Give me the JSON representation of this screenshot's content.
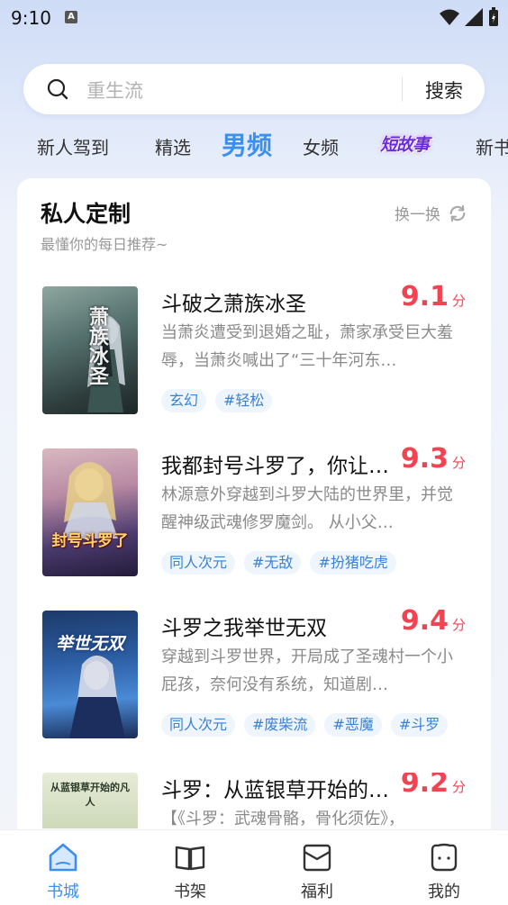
{
  "status_bar": {
    "time": "9:10",
    "badge": "A"
  },
  "search": {
    "placeholder": "重生流",
    "button": "搜索"
  },
  "tabs": [
    {
      "label": "新人驾到"
    },
    {
      "label": "精选"
    },
    {
      "label": "男频",
      "active": true
    },
    {
      "label": "女频"
    },
    {
      "label": "短故事"
    },
    {
      "label": "新书"
    }
  ],
  "section": {
    "title": "私人定制",
    "subtitle": "最懂你的每日推荐~",
    "refresh": "换一换"
  },
  "books": [
    {
      "title": "斗破之萧族冰圣",
      "score": "9.1",
      "unit": "分",
      "desc": "当萧炎遭受到退婚之耻，萧家承受巨大羞辱，当萧炎喊出了“三十年河东…",
      "tags": [
        "玄幻",
        "#轻松"
      ],
      "cover_text": "萧族冰圣"
    },
    {
      "title": "我都封号斗罗了，你让…",
      "score": "9.3",
      "unit": "分",
      "desc": "林源意外穿越到斗罗大陆的世界里，并觉醒神级武魂修罗魔剑。 从小父…",
      "tags": [
        "同人次元",
        "#无敌",
        "#扮猪吃虎"
      ],
      "cover_text": "封号斗罗了"
    },
    {
      "title": "斗罗之我举世无双",
      "score": "9.4",
      "unit": "分",
      "desc": "穿越到斗罗世界，开局成了圣魂村一个小屁孩，奈何没有系统，知道剧…",
      "tags": [
        "同人次元",
        "#废柴流",
        "#恶魔",
        "#斗罗"
      ],
      "cover_text": "举世无双"
    },
    {
      "title": "斗罗：从蓝银草开始的…",
      "score": "9.2",
      "unit": "分",
      "desc": "【《斗罗：武魂骨骼，骨化须佐》，",
      "tags": [],
      "cover_text": "从蓝银草开始的凡人"
    }
  ],
  "bottom_nav": [
    {
      "label": "书城",
      "icon": "home-icon",
      "active": true
    },
    {
      "label": "书架",
      "icon": "book-icon"
    },
    {
      "label": "福利",
      "icon": "gift-icon"
    },
    {
      "label": "我的",
      "icon": "profile-icon"
    }
  ],
  "colors": {
    "accent": "#3b8ff0",
    "score": "#f04452",
    "tag_text": "#3a82d8",
    "tag_bg": "#eef5fd"
  }
}
